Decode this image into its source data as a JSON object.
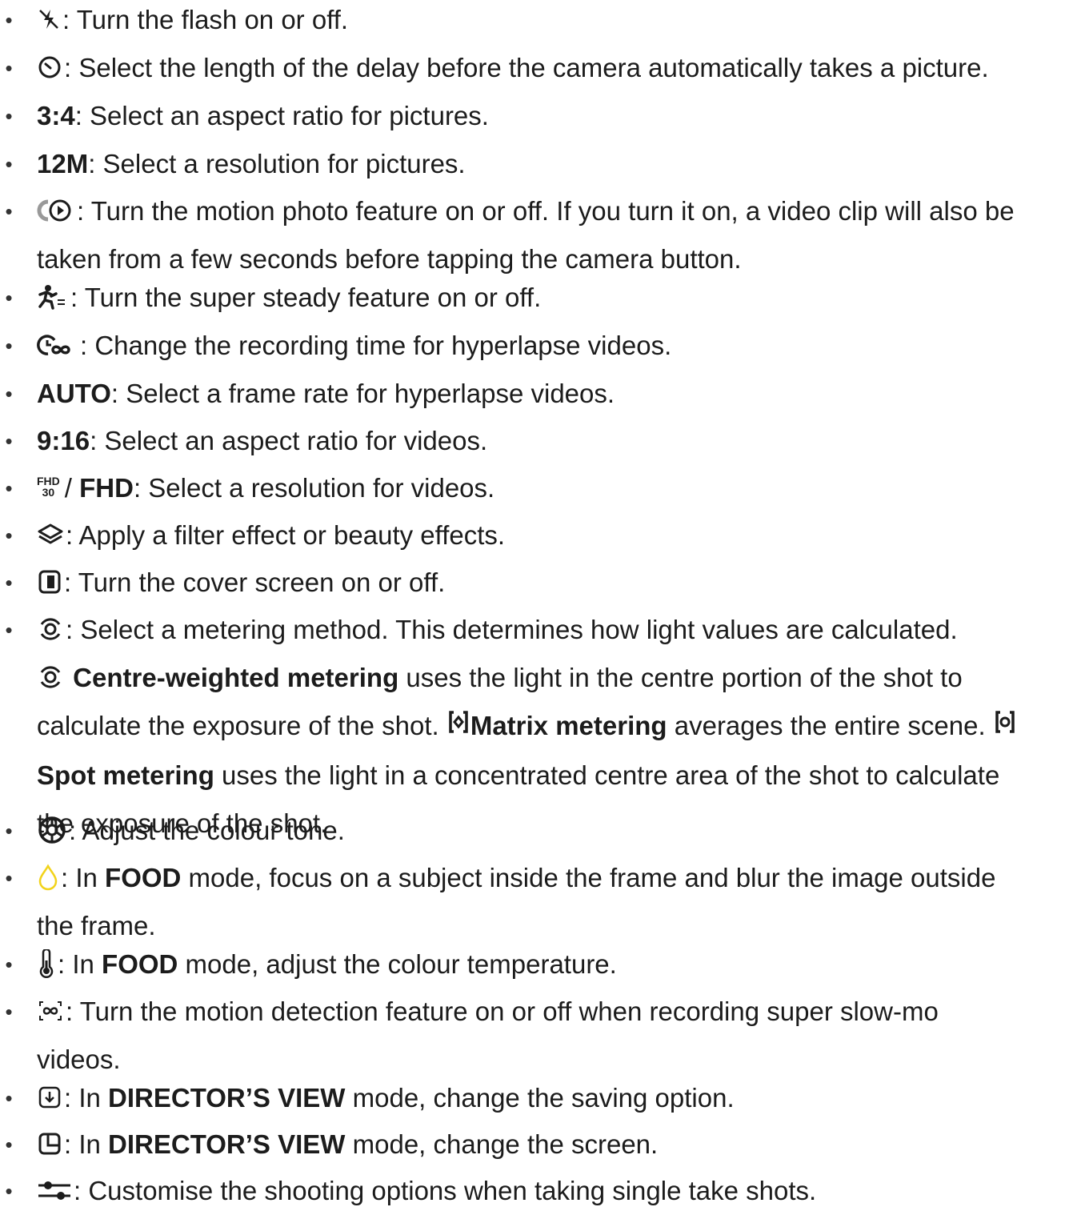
{
  "items": [
    {
      "icon": "flash-icon",
      "text": ": Turn the flash on or off."
    },
    {
      "icon": "timer-icon",
      "text": ": Select the length of the delay before the camera automatically takes a picture."
    },
    {
      "bold": "3:4",
      "text": ": Select an aspect ratio for pictures."
    },
    {
      "bold": "12M",
      "text": ": Select a resolution for pictures."
    },
    {
      "icon": "motion-photo-icon",
      "text": ": Turn the motion photo feature on or off. If you turn it on, a video clip will also be",
      "text2": "taken from a few seconds before tapping the camera button."
    },
    {
      "icon": "super-steady-icon",
      "text": ": Turn the super steady feature on or off."
    },
    {
      "icon": "hyperlapse-time-icon",
      "text": ": Change the recording time for hyperlapse videos."
    },
    {
      "bold": "AUTO",
      "text": ": Select a frame rate for hyperlapse videos."
    },
    {
      "bold": "9:16",
      "text": ": Select an aspect ratio for videos."
    },
    {
      "fhd_icon_top": "FHD",
      "fhd_icon_bottom": "30",
      "sep": "/",
      "bold": "FHD",
      "text": ": Select a resolution for videos."
    },
    {
      "icon": "filter-icon",
      "text": ": Apply a filter effect or beauty effects."
    },
    {
      "icon": "cover-screen-icon",
      "text": ": Turn the cover screen on or off."
    },
    {
      "icon": "metering-icon",
      "text": ": Select a metering method. This determines how light values are calculated.",
      "centre_label": "Centre-weighted metering",
      "centre_text": "uses the light in the centre portion of the shot to",
      "line3a": "calculate the exposure of the shot.",
      "matrix_label": "Matrix metering",
      "matrix_text": "averages the entire scene.",
      "spot_label": "Spot metering",
      "spot_text": "uses the light in a concentrated centre area of the shot to calculate",
      "line5": "the exposure of the shot."
    },
    {
      "icon": "colour-tone-icon",
      "text": ": Adjust the colour tone."
    },
    {
      "icon": "food-focus-icon",
      "pre": ": In",
      "bold": "FOOD",
      "text": "mode, focus on a subject inside the frame and blur the image outside",
      "text2": "the frame."
    },
    {
      "icon": "temperature-icon",
      "pre": ": In",
      "bold": "FOOD",
      "text": "mode, adjust the colour temperature."
    },
    {
      "icon": "motion-detection-icon",
      "text": ": Turn the motion detection feature on or off when recording super slow-mo",
      "text2": "videos."
    },
    {
      "icon": "saving-option-icon",
      "pre": ": In",
      "bold": "DIRECTOR’S VIEW",
      "text": "mode, change the saving option."
    },
    {
      "icon": "screen-layout-icon",
      "pre": ": In",
      "bold": "DIRECTOR’S VIEW",
      "text": "mode, change the screen."
    },
    {
      "icon": "shooting-options-icon",
      "text": ": Customise the shooting options when taking single take shots."
    }
  ],
  "bullet": "•",
  "colors": {
    "text": "#1c1c1c",
    "food_focus_icon": "#f2d31a"
  }
}
